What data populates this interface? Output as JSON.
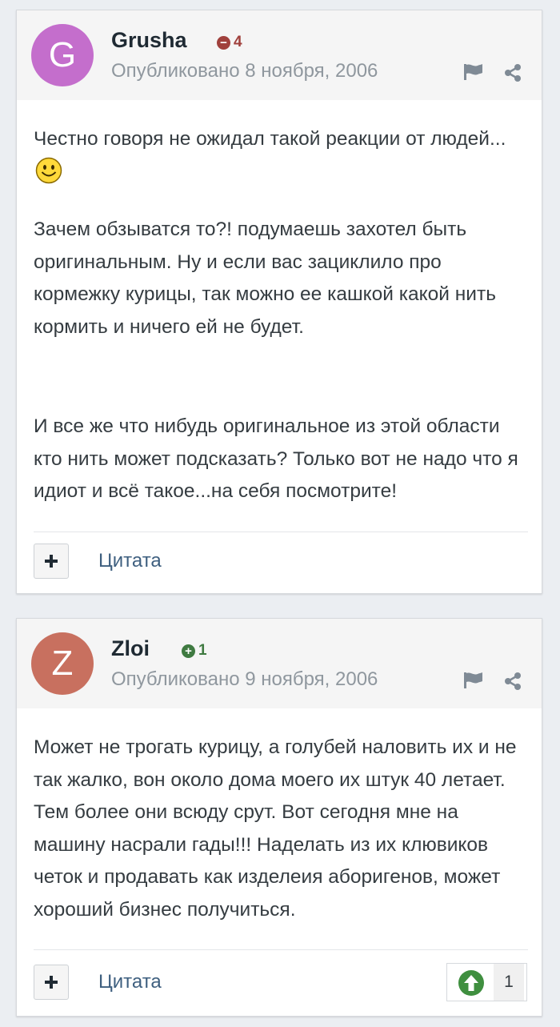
{
  "colors": {
    "avatar_grusha": "#c46ecc",
    "avatar_zloi": "#c8705f",
    "rep_negative": "#a0403c",
    "rep_positive": "#3f7a41",
    "link": "#3e5f7f",
    "vote_up": "#3f8f3f"
  },
  "posts": [
    {
      "avatar_letter": "G",
      "author": "Grusha",
      "reputation": "4",
      "reputation_sign": "negative",
      "date": "Опубликовано 8 ноября, 2006",
      "paragraphs": [
        "Честно говоря не ожидал такой реакции от людей...",
        "Зачем обзыватся то?! подумаешь захотел быть оригинальным. Ну и если вас зациклило про кормежку курицы, так можно ее кашкой какой нить кормить и ничего ей не будет.",
        "И все же что нибудь оригинальное из этой области кто нить может подсказать? Только вот не надо что я идиот и всё такое...на себя посмотрите!"
      ],
      "smiley_icon": "smile-emoji",
      "quote_label": "Цитата"
    },
    {
      "avatar_letter": "Z",
      "author": "Zloi",
      "reputation": "1",
      "reputation_sign": "positive",
      "date": "Опубликовано 9 ноября, 2006",
      "paragraphs": [
        "Может не трогать курицу, а голубей наловить их и не так жалко, вон около дома моего их штук 40 летает. Тем более они всюду срут. Вот сегодня мне на машину насрали гады!!! Наделать из их клювиков четок и продавать как изделеия аборигенов, может хороший бизнес получиться."
      ],
      "quote_label": "Цитата",
      "reactions_count": "1"
    }
  ]
}
